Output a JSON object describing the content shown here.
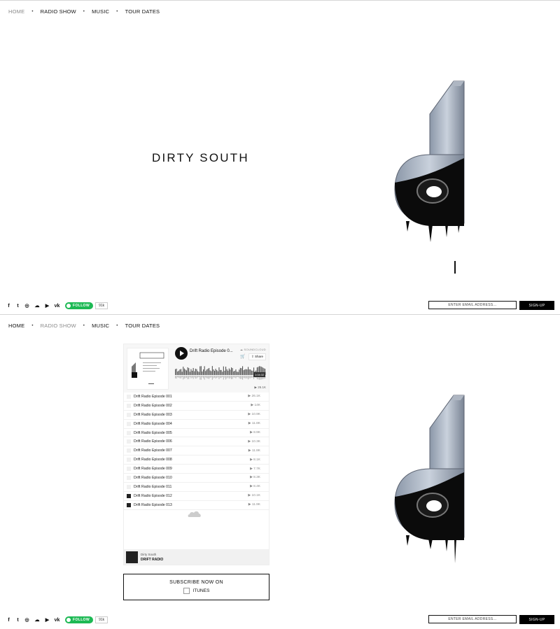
{
  "nav": {
    "items": [
      {
        "label": "HOME"
      },
      {
        "label": "RADIO SHOW"
      },
      {
        "label": "MUSIC"
      },
      {
        "label": "TOUR DATES"
      }
    ]
  },
  "hero": {
    "title": "DIRTY SOUTH"
  },
  "social": {
    "spotify_follow": "FOLLOW",
    "spotify_count": "91k"
  },
  "signup": {
    "placeholder": "ENTER EMAIL ADDRESS...",
    "button": "SIGN-UP"
  },
  "soundcloud": {
    "track_title": "Drift Radio Episode 0...",
    "brand": "SOUNDCLOUD",
    "share": "Share",
    "duration": "1:04:32",
    "plays": "26.1K",
    "episodes": [
      {
        "name": "Drift Radio Episode 001",
        "plays": "26.1K"
      },
      {
        "name": "Drift Radio Episode 002",
        "plays": "14K"
      },
      {
        "name": "Drift Radio Episode 003",
        "plays": "10.9K"
      },
      {
        "name": "Drift Radio Episode 004",
        "plays": "11.8K"
      },
      {
        "name": "Drift Radio Episode 005",
        "plays": "8.9K"
      },
      {
        "name": "Drift Radio Episode 006",
        "plays": "10.3K"
      },
      {
        "name": "Drift Radio Episode 007",
        "plays": "11.8K"
      },
      {
        "name": "Drift Radio Episode 008",
        "plays": "8.1K"
      },
      {
        "name": "Drift Radio Episode 009",
        "plays": "7.7K"
      },
      {
        "name": "Drift Radio Episode 010",
        "plays": "8.3K"
      },
      {
        "name": "Drift Radio Episode 011",
        "plays": "8.4K"
      },
      {
        "name": "Drift Radio Episode 012",
        "plays": "10.1K"
      },
      {
        "name": "Drift Radio Episode 013",
        "plays": "11.9K"
      }
    ],
    "footer_user": "Dirty South",
    "footer_playlist": "DRIFT RADIO"
  },
  "itunes": {
    "line1": "SUBSCRIBE NOW ON",
    "line2": "ITUNES"
  }
}
